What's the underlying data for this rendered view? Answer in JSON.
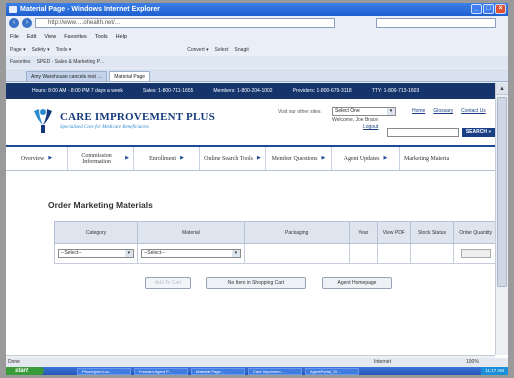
{
  "window": {
    "title": "Material Page - Windows Internet Explorer"
  },
  "browser": {
    "address": "http://www.…ohealth.net/…",
    "search_placeholder": "",
    "menu": [
      "File",
      "Edit",
      "View",
      "Favorites",
      "Tools",
      "Help"
    ],
    "toolbar": [
      "Page ▾",
      "Safety ▾",
      "Tools ▾",
      "Convert ▾",
      "Select",
      "Snagit"
    ],
    "favorites": [
      "Favorites",
      "SPED - Sales & Marketing P…"
    ],
    "tabs": [
      "Amy Warehouse cancels rest …",
      "Material Page"
    ]
  },
  "infobar": {
    "hours": "Hours: 8:00 AM - 8:00 PM 7 days a week",
    "sales": "Sales: 1-800-711-1655",
    "members": "Members: 1-800-204-1002",
    "providers": "Providers: 1-800-679-3118",
    "tty": "TTY: 1-800-713-1603"
  },
  "header": {
    "brand": "CARE IMPROVEMENT PLUS",
    "tagline": "Specialized Care for Medicare Beneficiaries",
    "other_link": "Visit our other sites:",
    "site_select": "Select One",
    "links": [
      "Home",
      "Glossary",
      "Contact Us"
    ],
    "welcome": "Welcome, Joe Brace",
    "logout": "Logout",
    "search_button": "SEARCH »"
  },
  "nav": [
    {
      "label": "Overview"
    },
    {
      "label": "Commission Information"
    },
    {
      "label": "Enrollment"
    },
    {
      "label": "Online Search Tools"
    },
    {
      "label": "Member Questions"
    },
    {
      "label": "Agent Updates"
    },
    {
      "label": "Marketing Materia"
    }
  ],
  "main": {
    "title": "Order Marketing Materials",
    "columns": [
      "Category",
      "Material",
      "Packaging",
      "Year",
      "View PDF",
      "Stock Status",
      "Order Quantity"
    ],
    "category_select": "--Select--",
    "material_select": "--Select--",
    "buttons": {
      "add_to_cart": "Add To Cart",
      "cart_status": "No Item in Shopping Cart",
      "homepage": "Agent Homepage"
    }
  },
  "status": {
    "left": "Done",
    "zone": "Internet",
    "zoom": "100%"
  },
  "taskbar": {
    "start": "start",
    "tasks": [
      "Phone|perol.co…",
      "Forward Agent P…",
      "Material Page …",
      "Care Improvem…",
      "AgentPortal_Gl…"
    ],
    "clock": "11:17 AM"
  },
  "colors": {
    "brand_navy": "#15346b",
    "accent_blue": "#2c8bd1"
  }
}
